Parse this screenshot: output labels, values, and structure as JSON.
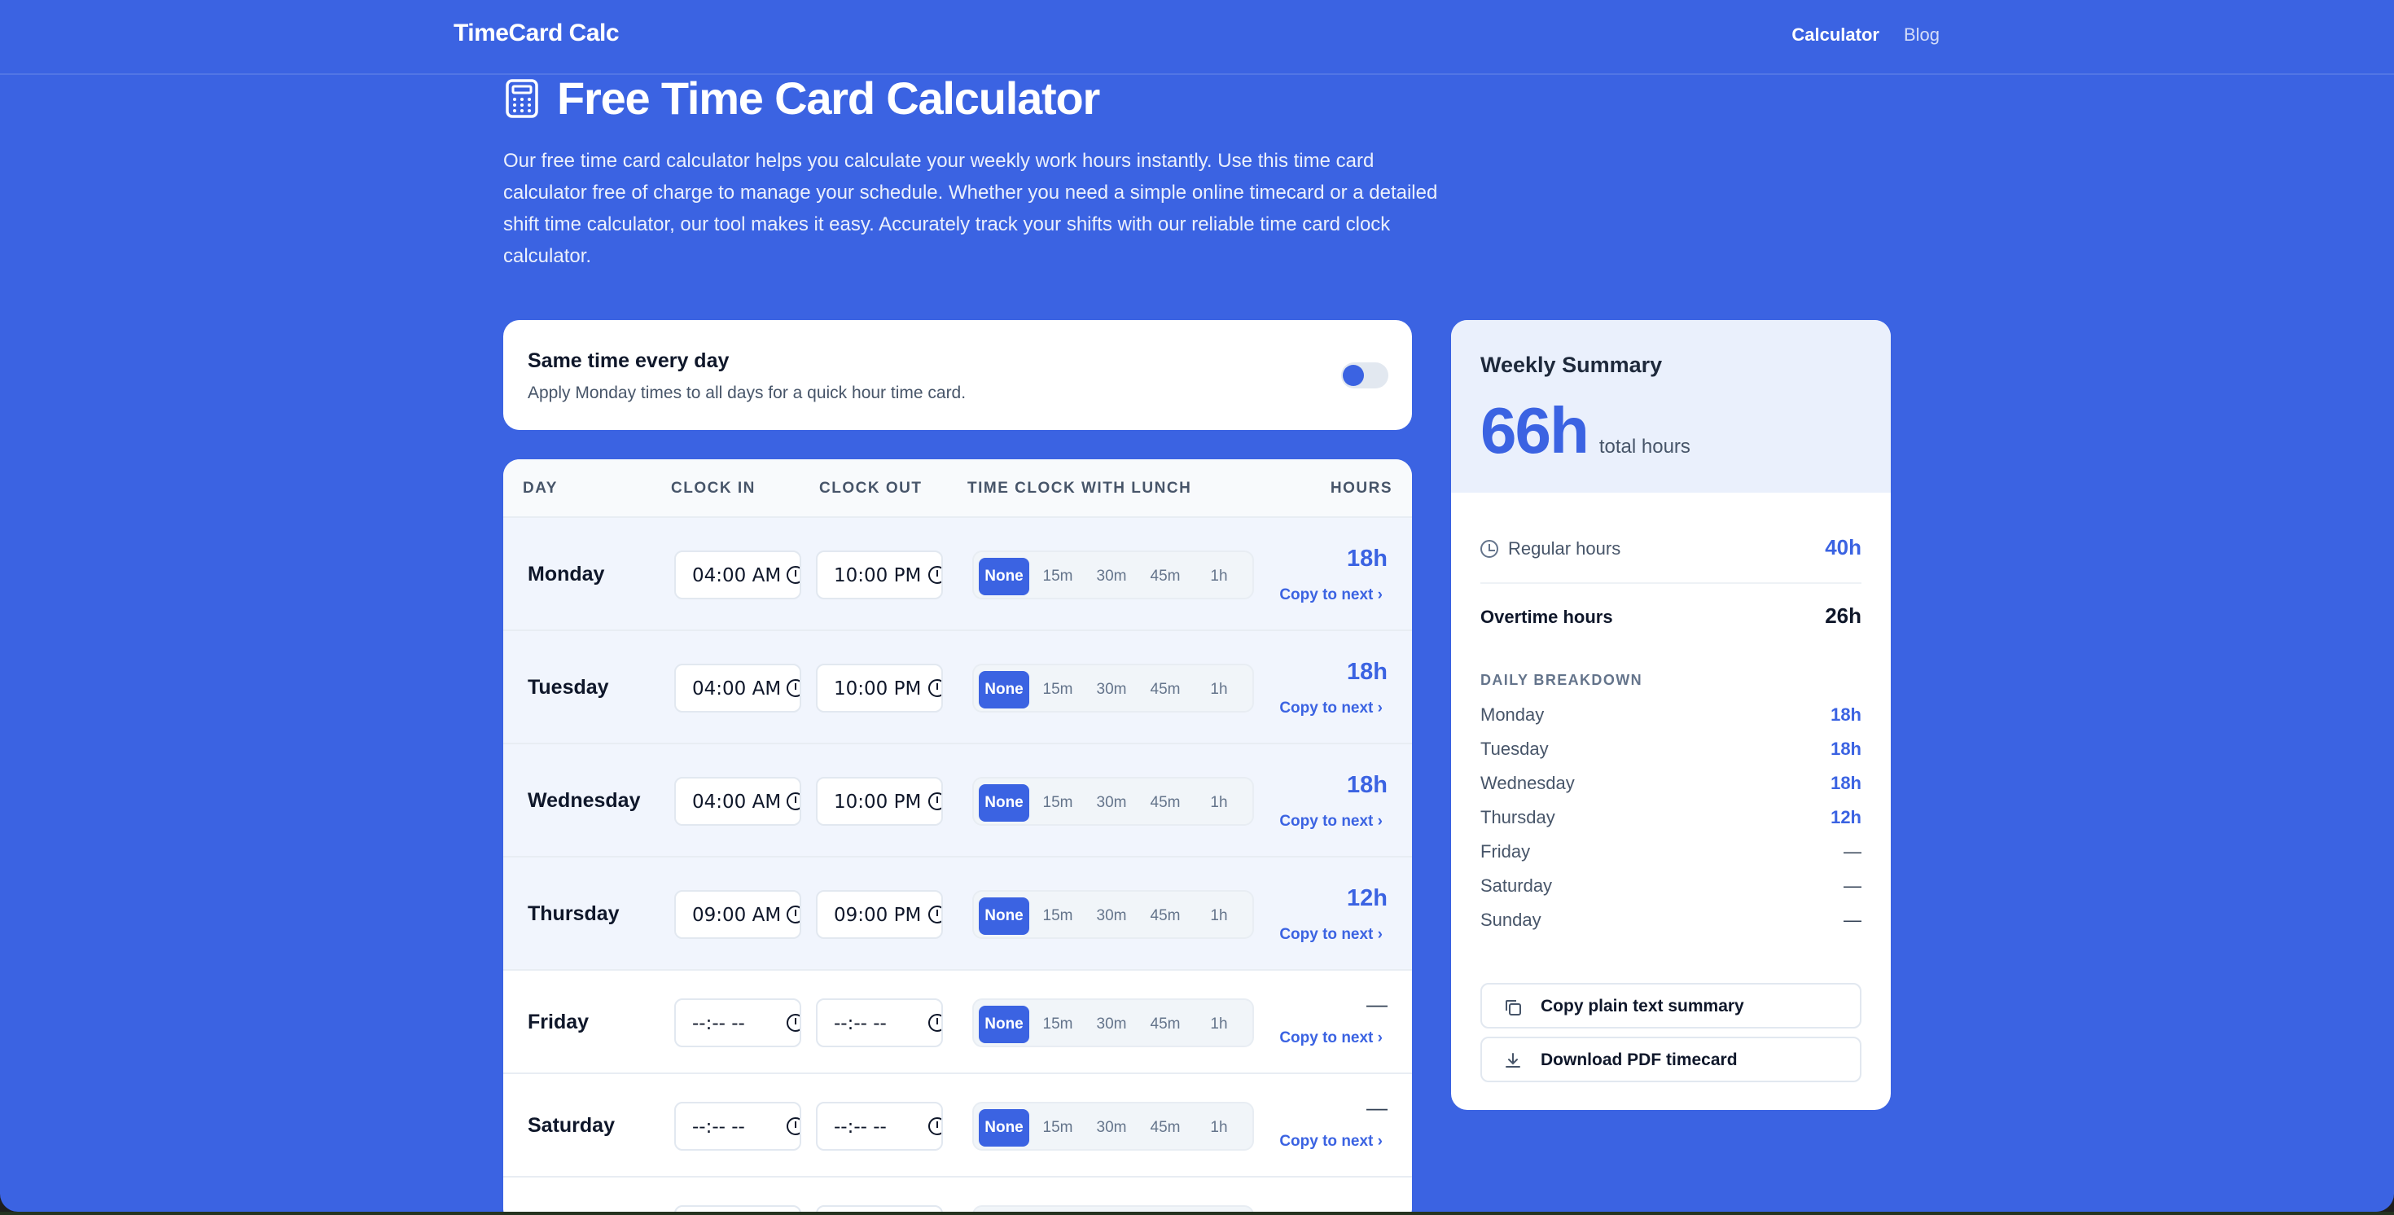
{
  "header": {
    "brand": "TimeCard Calc",
    "nav": [
      {
        "label": "Calculator",
        "active": true
      },
      {
        "label": "Blog",
        "active": false
      }
    ]
  },
  "hero": {
    "icon": "calculator-icon",
    "title": "Free Time Card Calculator",
    "description": "Our free time card calculator helps you calculate your weekly work hours instantly. Use this time card calculator free of charge to manage your schedule. Whether you need a simple online timecard or a detailed shift time calculator, our tool makes it easy. Accurately track your shifts with our reliable time card clock calculator."
  },
  "same_time": {
    "title": "Same time every day",
    "subtitle": "Apply Monday times to all days for a quick hour time card.",
    "enabled": false
  },
  "table": {
    "headers": {
      "day": "DAY",
      "clock_in": "CLOCK IN",
      "clock_out": "CLOCK OUT",
      "lunch": "TIME CLOCK WITH LUNCH",
      "hours": "HOURS"
    },
    "lunch_options": [
      "None",
      "15m",
      "30m",
      "45m",
      "1h"
    ],
    "copy_label": "Copy to next ›",
    "rows": [
      {
        "day": "Monday",
        "clock_in": "04:00 AM",
        "clock_out": "10:00 PM",
        "lunch": "None",
        "hours": "18h"
      },
      {
        "day": "Tuesday",
        "clock_in": "04:00 AM",
        "clock_out": "10:00 PM",
        "lunch": "None",
        "hours": "18h"
      },
      {
        "day": "Wednesday",
        "clock_in": "04:00 AM",
        "clock_out": "10:00 PM",
        "lunch": "None",
        "hours": "18h"
      },
      {
        "day": "Thursday",
        "clock_in": "09:00 AM",
        "clock_out": "09:00 PM",
        "lunch": "None",
        "hours": "12h"
      },
      {
        "day": "Friday",
        "clock_in": "--:-- --",
        "clock_out": "--:-- --",
        "lunch": "None",
        "hours": "—"
      },
      {
        "day": "Saturday",
        "clock_in": "--:-- --",
        "clock_out": "--:-- --",
        "lunch": "None",
        "hours": "—"
      }
    ]
  },
  "summary": {
    "title": "Weekly Summary",
    "total_value": "66h",
    "total_label": "total hours",
    "regular_label": "Regular hours",
    "regular_value": "40h",
    "overtime_label": "Overtime hours",
    "overtime_value": "26h",
    "breakdown_title": "DAILY BREAKDOWN",
    "breakdown": [
      {
        "day": "Monday",
        "value": "18h"
      },
      {
        "day": "Tuesday",
        "value": "18h"
      },
      {
        "day": "Wednesday",
        "value": "18h"
      },
      {
        "day": "Thursday",
        "value": "12h"
      },
      {
        "day": "Friday",
        "value": "—"
      },
      {
        "day": "Saturday",
        "value": "—"
      },
      {
        "day": "Sunday",
        "value": "—"
      }
    ],
    "copy_button": "Copy plain text summary",
    "download_button": "Download PDF timecard"
  },
  "colors": {
    "accent": "#3b63e2",
    "page_bg": "#3b63e2",
    "card_bg": "#ffffff"
  }
}
